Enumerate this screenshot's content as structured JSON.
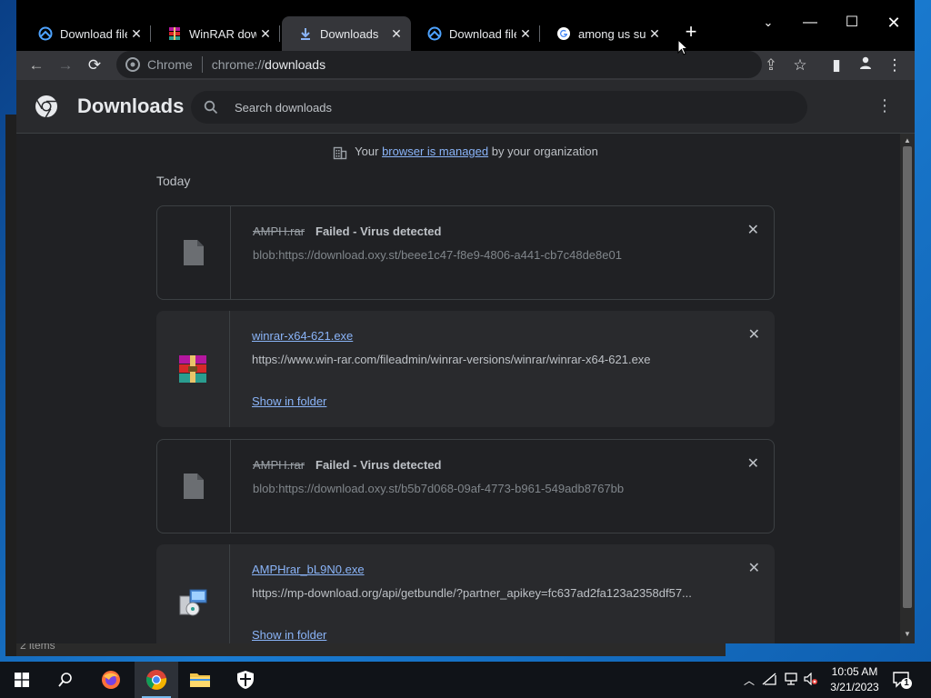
{
  "tabs": [
    {
      "title": "Download file",
      "icon": "download-cloud-icon",
      "active": false
    },
    {
      "title": "WinRAR download",
      "icon": "winrar-icon",
      "active": false
    },
    {
      "title": "Downloads",
      "icon": "download-arrow-icon",
      "active": true
    },
    {
      "title": "Download file",
      "icon": "download-cloud-icon",
      "active": false
    },
    {
      "title": "among us sus",
      "icon": "google-icon",
      "active": false
    }
  ],
  "omnibox": {
    "chip": "Chrome",
    "scheme": "chrome://",
    "host": "downloads"
  },
  "downloads_page": {
    "title": "Downloads",
    "search_placeholder": "Search downloads",
    "managed_prefix": "Your ",
    "managed_link": "browser is managed",
    "managed_suffix": " by your organization",
    "day_label": "Today"
  },
  "items": [
    {
      "name": "AMPH.rar",
      "status": "Failed - Virus detected",
      "url": "blob:https://download.oxy.st/beee1c47-f8e9-4806-a441-cb7c48de8e01",
      "failed": true
    },
    {
      "name": "winrar-x64-621.exe",
      "url": "https://www.win-rar.com/fileadmin/winrar-versions/winrar/winrar-x64-621.exe",
      "action": "Show in folder",
      "failed": false
    },
    {
      "name": "AMPH.rar",
      "status": "Failed - Virus detected",
      "url": "blob:https://download.oxy.st/b5b7d068-09af-4773-b961-549adb8767bb",
      "failed": true
    },
    {
      "name": "AMPHrar_bL9N0.exe",
      "url": "https://mp-download.org/api/getbundle/?partner_apikey=fc637ad2fa123a2358df57...",
      "action": "Show in folder",
      "failed": false
    }
  ],
  "background_status": "2 items",
  "taskbar": {
    "time": "10:05 AM",
    "date": "3/21/2023",
    "notification_count": "1"
  },
  "colors": {
    "accent_link": "#8ab4f8",
    "page_bg": "#202124",
    "taskbar_bg": "#101318"
  }
}
